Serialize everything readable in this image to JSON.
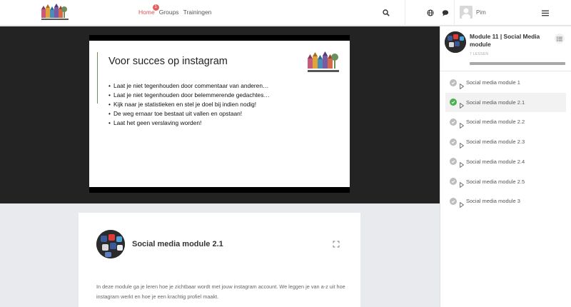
{
  "header": {
    "nav": [
      {
        "label": "Home",
        "badge": "1"
      },
      {
        "label": "Groups"
      },
      {
        "label": "Trainingen"
      }
    ],
    "user": {
      "name": "Pim"
    },
    "icons": [
      "search-icon",
      "globe-icon",
      "chat-icon",
      "menu-icon"
    ]
  },
  "slide": {
    "title": "Voor succes op instagram",
    "bullets": [
      "Laat je niet tegenhouden door commentaar van anderen…",
      "Laat je niet tegenhouden door belemmerende gedachtes…",
      "Kijk naar je statistieken en stel je doel bij indien nodig!",
      "De weg ernaar toe bestaat uit vallen en opstaan!",
      "Laat het geen verslaving worden!"
    ]
  },
  "lesson": {
    "title": "Social media module 2.1",
    "description": "In deze module ga je leren hoe je zichtbaar wordt met jouw instagram account. We leggen je van a-z uit hoe instagram werkt en hoe je een krachtig profiel maakt."
  },
  "sidebar": {
    "module_title": "Module 11 | Social Media module",
    "lesson_count": "7 LESSEN",
    "progress": 1.0,
    "lessons": [
      {
        "label": "Social media module 1",
        "done": false,
        "active": false
      },
      {
        "label": "Social media module 2.1",
        "done": true,
        "active": true
      },
      {
        "label": "Social media module 2.2",
        "done": false,
        "active": false
      },
      {
        "label": "Social media module 2.3",
        "done": false,
        "active": false
      },
      {
        "label": "Social media module 2.4",
        "done": false,
        "active": false
      },
      {
        "label": "Social media module 2.5",
        "done": false,
        "active": false
      },
      {
        "label": "Social media module 3",
        "done": false,
        "active": false
      }
    ]
  },
  "colors": {
    "accent": "#d35454",
    "done": "#4caf50",
    "video_bg": "#232323",
    "page_bg": "#e9eaed"
  }
}
